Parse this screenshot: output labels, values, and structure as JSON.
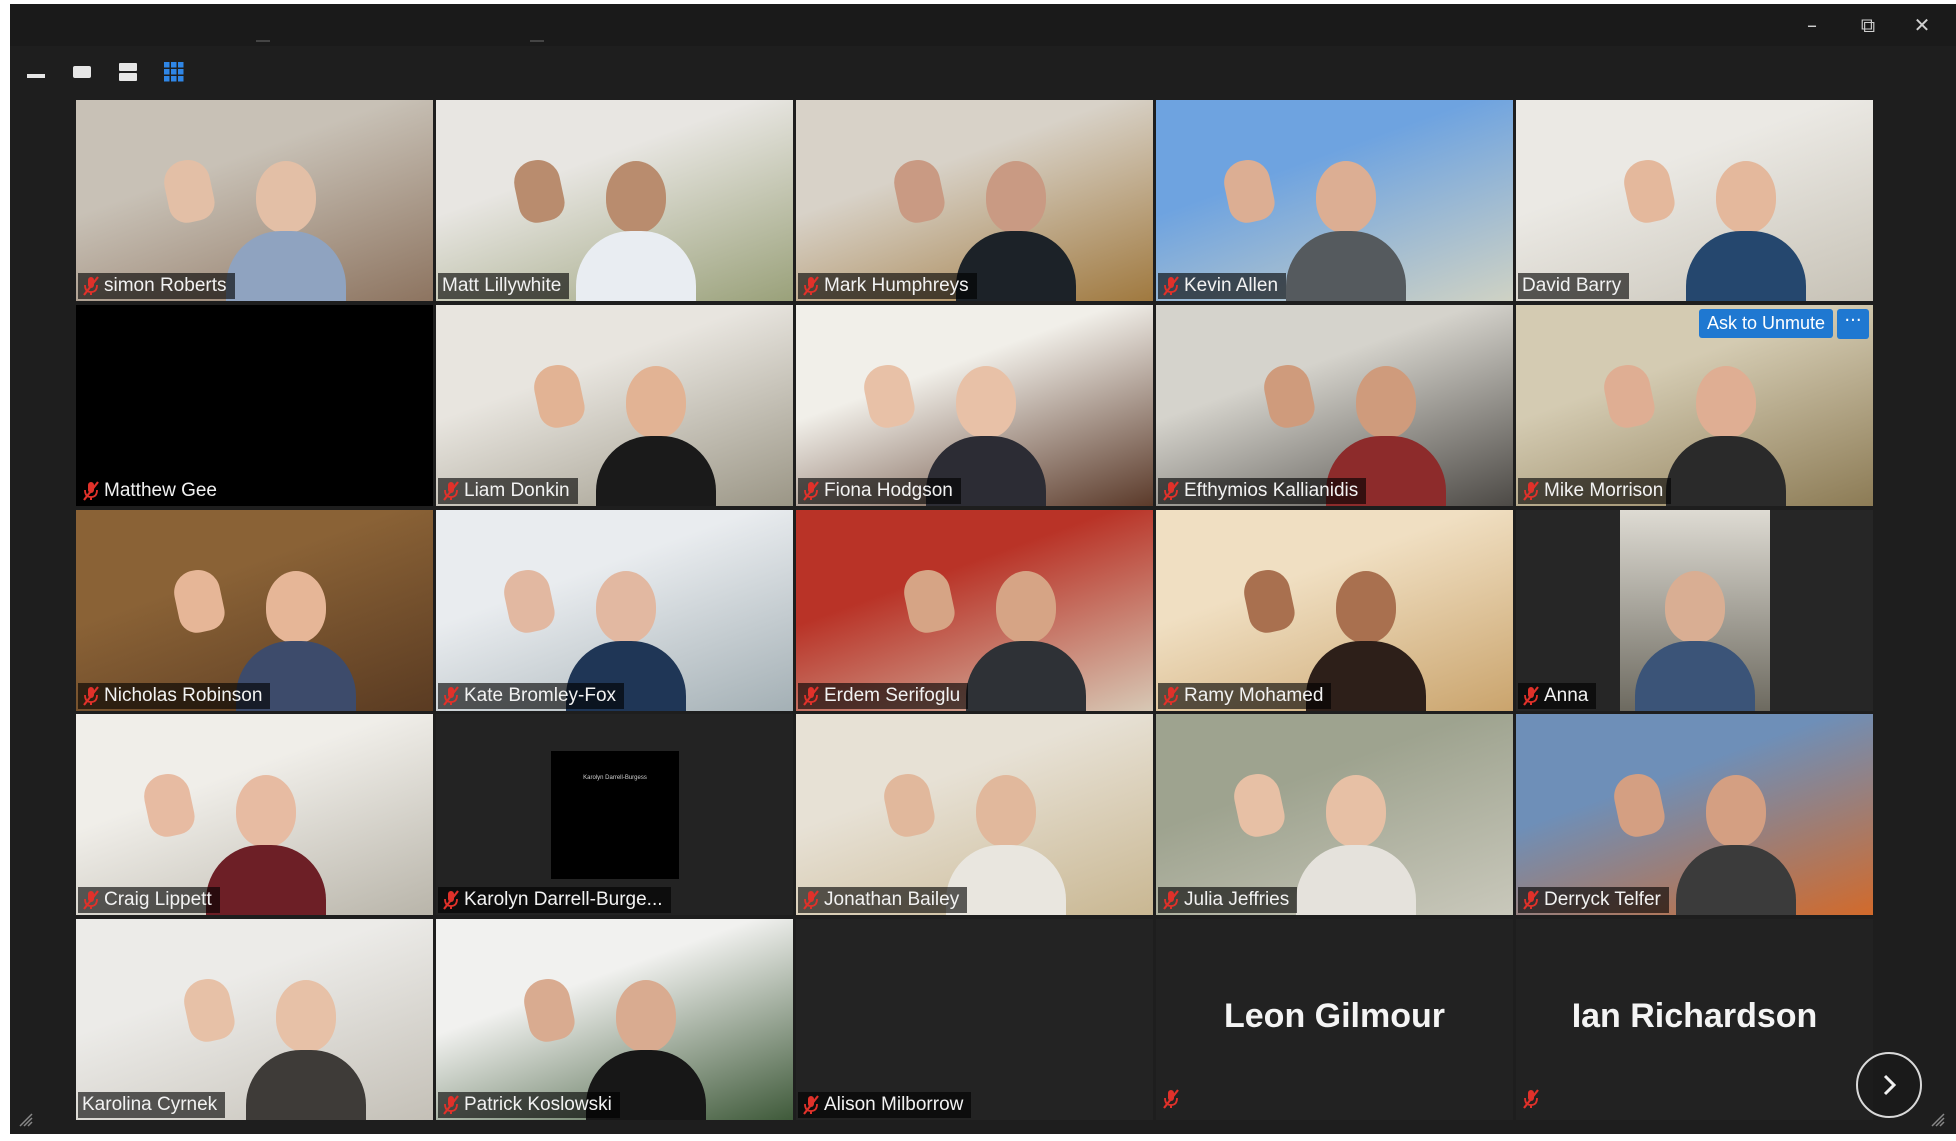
{
  "window": {
    "controls": {
      "minimize_icon": "–",
      "restore_icon": "⧉",
      "close_icon": "✕"
    }
  },
  "toolbar": {
    "views": [
      "minimize-view",
      "speaker-view",
      "strip-view",
      "gallery-view"
    ],
    "active_view": "gallery-view",
    "accent": "#2f86e6"
  },
  "grid": {
    "active_border_color": "#d8e46a",
    "mute_color": "#e0312a",
    "rows": [
      [
        {
          "name": "simon Roberts",
          "muted": true,
          "active": true,
          "bg": [
            "#c8c1b6",
            "#8d7460"
          ],
          "shirt": "#8fa3c0",
          "skin": "#e3bfa6"
        },
        {
          "name": "Matt Lillywhite",
          "muted": false,
          "bg": [
            "#e8e6e2",
            "#9aa17a"
          ],
          "shirt": "#e9edf2",
          "skin": "#b98c6e"
        },
        {
          "name": "Mark Humphreys",
          "muted": true,
          "bg": [
            "#d8d2c8",
            "#a0793f"
          ],
          "shirt": "#1c2228",
          "skin": "#c99a83"
        },
        {
          "name": "Kevin Allen",
          "muted": true,
          "bg": [
            "#6ea3e0",
            "#cfd2c4"
          ],
          "shirt": "#555a5e",
          "skin": "#dcae93"
        },
        {
          "name": "David Barry",
          "muted": false,
          "bg": [
            "#ebe9e4",
            "#c7c2b6"
          ],
          "shirt": "#25476e",
          "skin": "#e4b89c"
        }
      ],
      [
        {
          "name": "Matthew Gee",
          "muted": true,
          "video_off": true
        },
        {
          "name": "Liam Donkin",
          "muted": true,
          "bg": [
            "#e8e5df",
            "#9b9686"
          ],
          "shirt": "#1a1a1a",
          "skin": "#e2b394"
        },
        {
          "name": "Fiona Hodgson",
          "muted": true,
          "bg": [
            "#f1efe9",
            "#5b3a2a"
          ],
          "shirt": "#2c2c34",
          "skin": "#e8c1a7"
        },
        {
          "name": "Efthymios Kallianidis",
          "muted": true,
          "bg": [
            "#d5d3cc",
            "#4d4a46"
          ],
          "shirt": "#8d2b2b",
          "skin": "#cf9b7c"
        },
        {
          "name": "Mike Morrison",
          "muted": true,
          "bg": [
            "#d4cbb2",
            "#8c7b55"
          ],
          "shirt": "#2a2a2a",
          "skin": "#dfae93",
          "ask_to_unmute": "Ask to Unmute",
          "more": "···"
        }
      ],
      [
        {
          "name": "Nicholas Robinson",
          "muted": true,
          "bg": [
            "#8a6236",
            "#5a3b22"
          ],
          "shirt": "#3d4b6b",
          "skin": "#e6b697"
        },
        {
          "name": "Kate Bromley-Fox",
          "muted": true,
          "bg": [
            "#e9ecef",
            "#a4b0b5"
          ],
          "shirt": "#1f3656",
          "skin": "#e2b8a1"
        },
        {
          "name": "Erdem Serifoglu",
          "muted": true,
          "bg": [
            "#b93327",
            "#d7c8b5"
          ],
          "shirt": "#2e3136",
          "skin": "#d6a485"
        },
        {
          "name": "Ramy Mohamed",
          "muted": true,
          "bg": [
            "#f0dfc2",
            "#caa46d"
          ],
          "shirt": "#2d1f19",
          "skin": "#a9704f"
        },
        {
          "name": "Anna",
          "muted": true,
          "inset": true,
          "bg": [
            "#dedbd3",
            "#6d6a60"
          ],
          "shirt": "#3b5478",
          "skin": "#d9ae93"
        }
      ],
      [
        {
          "name": "Craig Lippett",
          "muted": true,
          "bg": [
            "#f0eee9",
            "#b9b5aa"
          ],
          "shirt": "#6d1f26",
          "skin": "#e7bba2"
        },
        {
          "name": "Karolyn Darrell-Burge...",
          "muted": true,
          "black_card": true,
          "card_text": "Karolyn Darrell-Burgess"
        },
        {
          "name": "Jonathan Bailey",
          "muted": true,
          "bg": [
            "#e7e1d5",
            "#c9b792"
          ],
          "shirt": "#e9e6df",
          "skin": "#e1b89c"
        },
        {
          "name": "Julia Jeffries",
          "muted": true,
          "bg": [
            "#9ea38f",
            "#c9c8bb"
          ],
          "shirt": "#e5e2dc",
          "skin": "#e7c0a5"
        },
        {
          "name": "Derryck Telfer",
          "muted": true,
          "bg": [
            "#6e8fb8",
            "#d26a2b"
          ],
          "shirt": "#3b3b3b",
          "skin": "#d49f82"
        }
      ],
      [
        {
          "name": "Karolina Cyrnek",
          "muted": false,
          "bg": [
            "#ecebe8",
            "#c4c0b7"
          ],
          "shirt": "#3e3b38",
          "skin": "#e7c1a7"
        },
        {
          "name": "Patrick Koslowski",
          "muted": true,
          "bg": [
            "#f1f1ef",
            "#3f5a3a"
          ],
          "shirt": "#171717",
          "skin": "#d9ab90"
        },
        {
          "name": "Alison Milborrow",
          "muted": true,
          "video_off": true
        },
        {
          "name_only": "Leon Gilmour",
          "muted": true
        },
        {
          "name_only": "Ian Richardson",
          "muted": true
        }
      ]
    ]
  },
  "next_page_icon": "chevron-right-icon"
}
